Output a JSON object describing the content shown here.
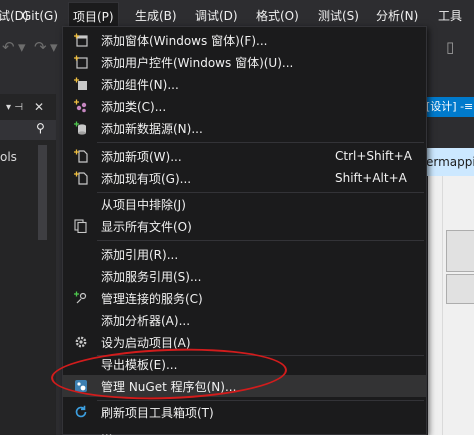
{
  "menubar": {
    "items": [
      {
        "label": "试(D)"
      },
      {
        "label": "Git(G)"
      },
      {
        "label": "项目(P)"
      },
      {
        "label": "生成(B)"
      },
      {
        "label": "调试(D)"
      },
      {
        "label": "格式(O)"
      },
      {
        "label": "测试(S)"
      },
      {
        "label": "分析(N)"
      },
      {
        "label": "工具"
      }
    ]
  },
  "left_panel": {
    "pin": "▾ ⊣",
    "close": "✕",
    "search_icon": "🔍",
    "text": "ols"
  },
  "right_area": {
    "tab_design": "[设计] -≡",
    "tab_mapping": "ermappi"
  },
  "project_menu": {
    "items": [
      {
        "label": "添加窗体(Windows 窗体)(F)...",
        "icon": "add-form-icon"
      },
      {
        "label": "添加用户控件(Windows 窗体)(U)...",
        "icon": "add-user-control-icon"
      },
      {
        "label": "添加组件(N)...",
        "icon": "add-component-icon"
      },
      {
        "label": "添加类(C)...",
        "icon": "add-class-icon"
      },
      {
        "label": "添加新数据源(N)...",
        "icon": "add-data-source-icon"
      },
      {
        "label": "添加新项(W)...",
        "shortcut": "Ctrl+Shift+A",
        "icon": "add-new-item-icon"
      },
      {
        "label": "添加现有项(G)...",
        "shortcut": "Shift+Alt+A",
        "icon": "add-existing-item-icon"
      },
      {
        "label": "从项目中排除(J)"
      },
      {
        "label": "显示所有文件(O)",
        "icon": "show-all-files-icon"
      },
      {
        "label": "添加引用(R)..."
      },
      {
        "label": "添加服务引用(S)..."
      },
      {
        "label": "管理连接的服务(C)",
        "icon": "connected-services-icon"
      },
      {
        "label": "添加分析器(A)..."
      },
      {
        "label": "设为启动项目(A)",
        "icon": "gear-icon"
      },
      {
        "label": "导出模板(E)..."
      },
      {
        "label": "管理 NuGet 程序包(N)...",
        "icon": "nuget-icon"
      },
      {
        "label": "刷新项目工具箱项(T)",
        "icon": "refresh-icon"
      },
      {
        "label": "..."
      }
    ]
  },
  "colors": {
    "background": "#2d2d30",
    "menu_background": "#1b1b1c",
    "highlight": "#d21c1c",
    "accent": "#007acc"
  }
}
